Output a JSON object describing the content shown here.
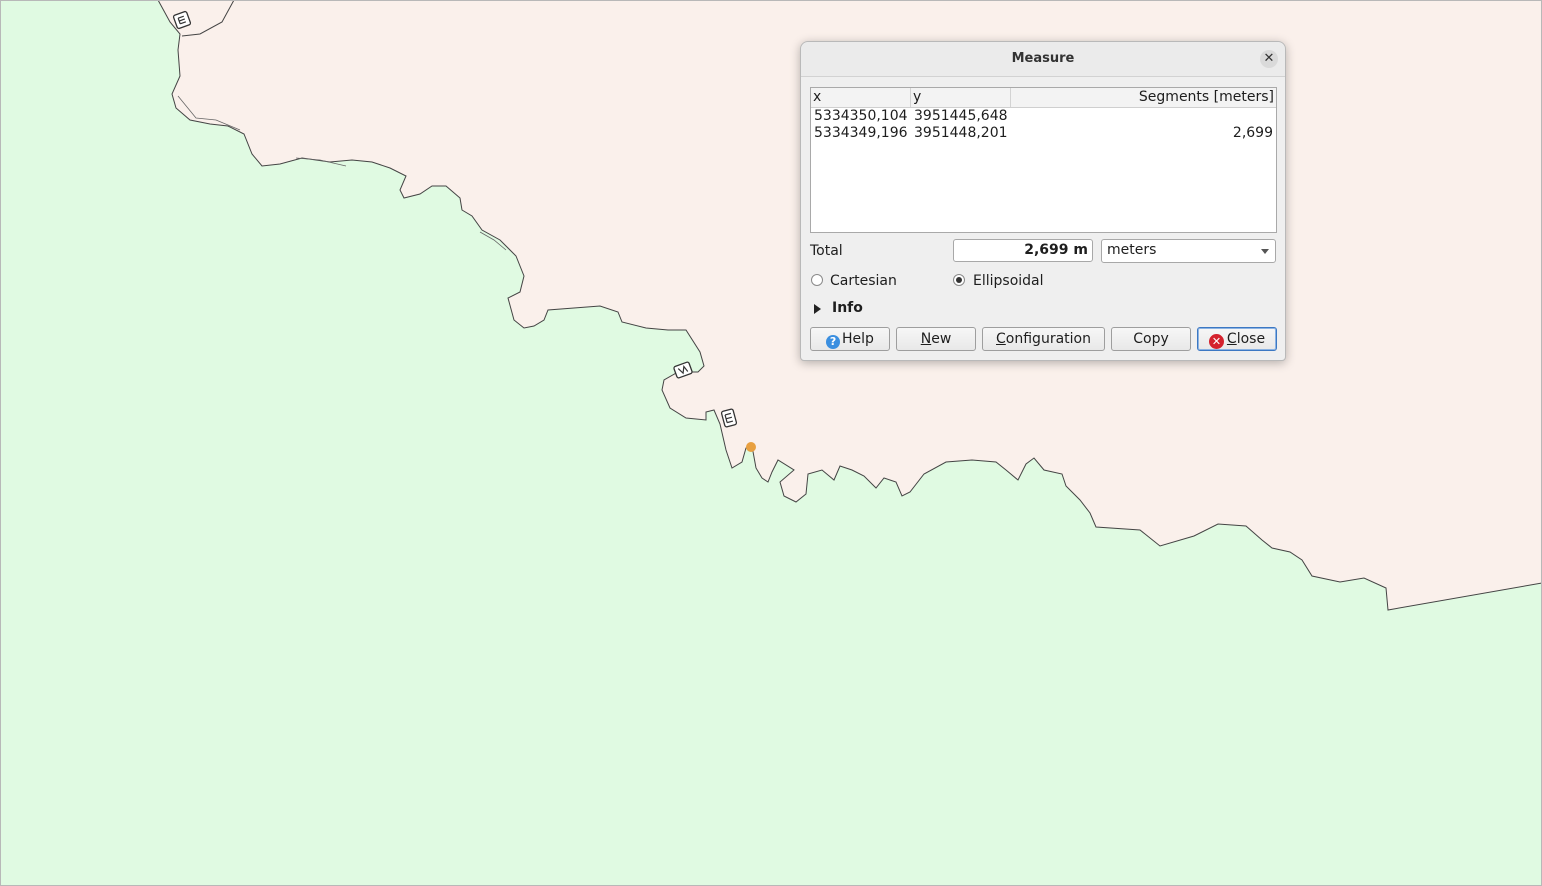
{
  "dialog": {
    "title": "Measure",
    "close_x": "✕",
    "table": {
      "headers": [
        "x",
        "y",
        "Segments [meters]"
      ],
      "rows": [
        {
          "x": "5334350,104",
          "y": "3951445,648",
          "segment": ""
        },
        {
          "x": "5334349,196",
          "y": "3951448,201",
          "segment": "2,699"
        }
      ]
    },
    "total_label": "Total",
    "total_value": "2,699 m",
    "units_selected": "meters",
    "cartesian_label": "Cartesian",
    "ellipsoidal_label": "Ellipsoidal",
    "info_label": "Info",
    "buttons": {
      "help_icon": "?",
      "help": "Help",
      "new_first": "N",
      "new_rest": "ew",
      "config_first": "C",
      "config_rest": "onfiguration",
      "copy": "Copy",
      "close_icon": "✕",
      "close_first": "C",
      "close_rest": "lose"
    }
  },
  "colors": {
    "land_green": "#e0fae2",
    "land_pink": "#faf0eb",
    "boundary": "#444444",
    "measure_point": "#e8a040"
  },
  "map_icons": [
    "road-shield-icon",
    "road-shield-icon",
    "road-shield-icon"
  ]
}
